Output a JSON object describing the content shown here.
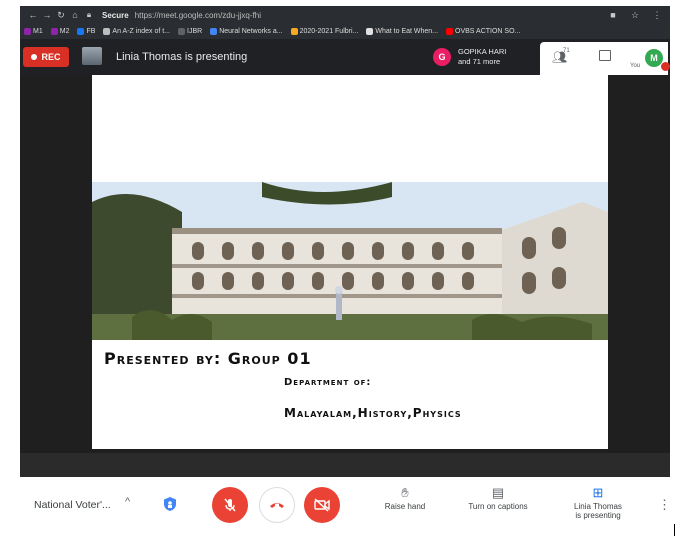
{
  "browser": {
    "secure_label": "Secure",
    "url": "https://meet.google.com/zdu-jjxq-fhi",
    "bookmarks": [
      "M1",
      "M2",
      "FB",
      "An A-Z index of t...",
      "IJBR",
      "Neural Networks a...",
      "2020-2021 Fulbri...",
      "What to Eat When...",
      "OVBS ACTION SO..."
    ]
  },
  "header": {
    "rec_label": "REC",
    "presenting_text": "Linia Thomas is presenting",
    "participant_initial": "G",
    "participant_name": "GOPIKA HARI",
    "participant_more": "and 71 more",
    "people_count": "71",
    "you_label": "You",
    "self_initial": "M"
  },
  "slide": {
    "line1": "Presented by: Group 01",
    "line2": "Department of:",
    "line3": "Malayalam,History,Physics"
  },
  "controls": {
    "meeting_name": "National Voter'...",
    "caret": "^",
    "raise_hand": "Raise hand",
    "captions": "Turn on captions",
    "present_line1": "Linia Thomas",
    "present_line2": "is presenting",
    "more": "⋮"
  },
  "colors": {
    "rec_red": "#d93025",
    "mic_red": "#ea4335",
    "self_avatar_green": "#34a853",
    "guest_avatar_pink": "#e91e63"
  }
}
